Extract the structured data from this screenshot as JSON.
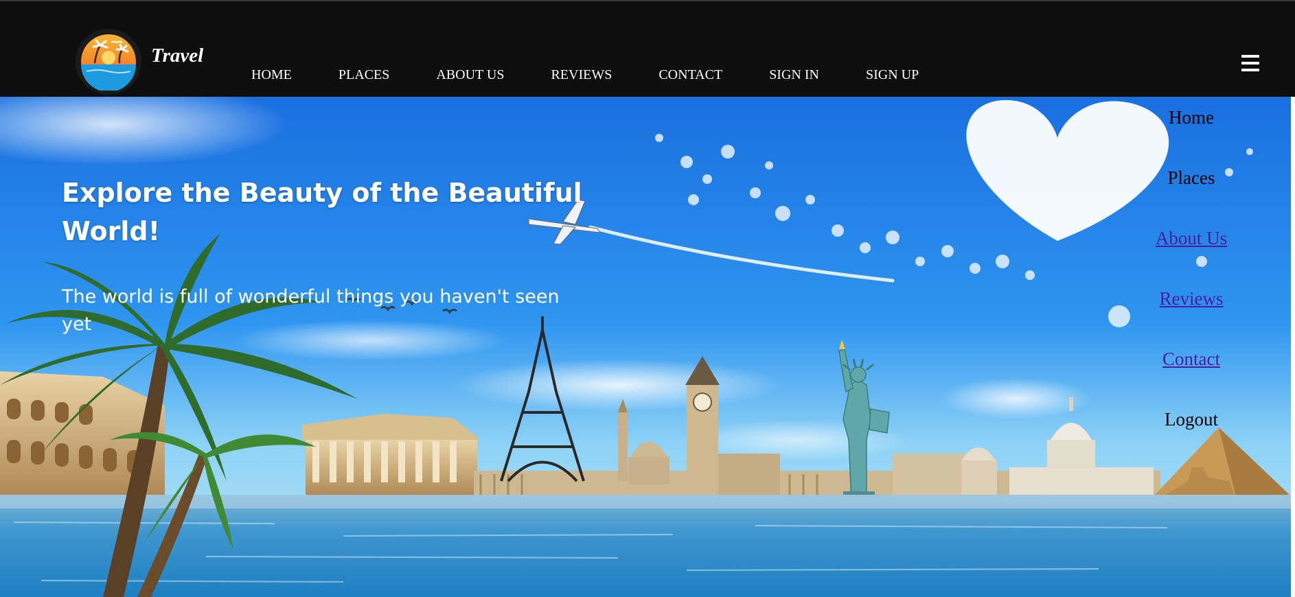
{
  "header": {
    "brand": "Travel",
    "nav": [
      "HOME",
      "PLACES",
      "ABOUT US",
      "REVIEWS",
      "CONTACT",
      "SIGN IN",
      "SIGN UP"
    ],
    "menu_icon": "hamburger-icon"
  },
  "hero": {
    "title": "Explore the Beauty of the Beautiful World!",
    "subtitle": "The world is full of wonderful things you haven't seen yet"
  },
  "side_menu": [
    {
      "label": "Home",
      "style": "plain"
    },
    {
      "label": "Places",
      "style": "plain"
    },
    {
      "label": "About Us",
      "style": "visited"
    },
    {
      "label": "Reviews",
      "style": "visited"
    },
    {
      "label": "Contact",
      "style": "visited"
    },
    {
      "label": "Logout",
      "style": "plain"
    }
  ],
  "colors": {
    "header_bg": "#0e0e0e",
    "sky_top": "#1f7ae8",
    "sky_bottom": "#8fd3f6",
    "visited_link": "#4b1d9c"
  }
}
